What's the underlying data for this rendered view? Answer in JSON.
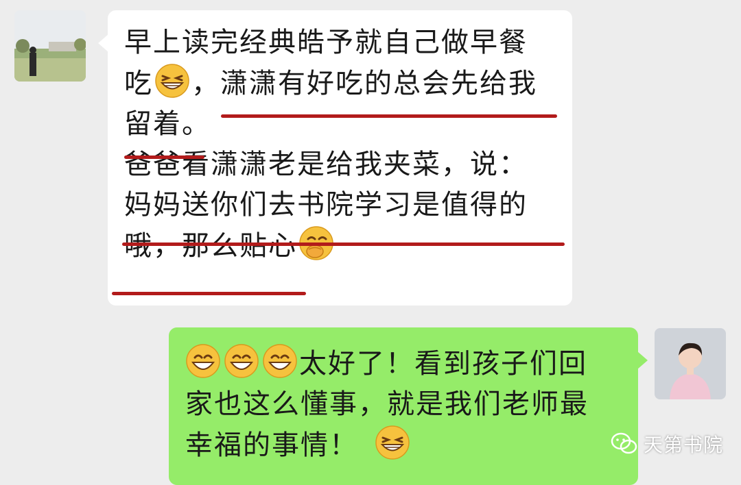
{
  "chat": {
    "left_message": {
      "line1": "早上读完经典皓予就自己做早餐",
      "line2_start": "吃",
      "line2_mid": "，",
      "line2_end": "潇潇有好吃的总会先给我",
      "line3": "留着。",
      "line4": "爸爸看潇潇老是给我夹菜，说：",
      "line5": "妈妈送你们去书院学习是值得的",
      "line6": "哦，那么贴心"
    },
    "right_message": {
      "line1_text": "太好了！看到孩子们回",
      "line2": "家也这么懂事，就是我们老师最",
      "line3": "幸福的事情！"
    }
  },
  "icons": {
    "left_emoji_1": "grinning-squint-face",
    "left_emoji_2": "hand-over-mouth-face",
    "right_emoji_1": "grinning-face",
    "right_emoji_2": "grinning-face",
    "right_emoji_3": "grinning-face",
    "right_emoji_4": "grinning-squint-face"
  },
  "watermark": {
    "label": "天第书院"
  },
  "colors": {
    "background": "#ededed",
    "incoming_bubble": "#ffffff",
    "outgoing_bubble": "#95ec69",
    "underline": "#b21b1b"
  }
}
